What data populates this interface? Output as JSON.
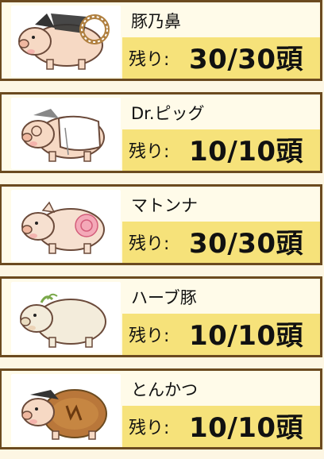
{
  "pigs": [
    {
      "name": "豚乃鼻",
      "remaining_label": "残り:",
      "remaining": "30/30頭",
      "icon": "pig-with-rope-icon"
    },
    {
      "name": "Dr.ピッグ",
      "remaining_label": "残り:",
      "remaining": "10/10頭",
      "icon": "doctor-pig-icon"
    },
    {
      "name": "マトンナ",
      "remaining_label": "残り:",
      "remaining": "30/30頭",
      "icon": "rose-pig-icon"
    },
    {
      "name": "ハーブ豚",
      "remaining_label": "残り:",
      "remaining": "10/10頭",
      "icon": "herb-pig-icon"
    },
    {
      "name": "とんかつ",
      "remaining_label": "残り:",
      "remaining": "10/10頭",
      "icon": "tonkatsu-pig-icon"
    }
  ],
  "colors": {
    "border": "#6b4a1f",
    "card_bg": "#fffbe9",
    "count_band": "#f6e27a",
    "pig_body": "#f6d9c4",
    "pig_outline": "#6b4a3a"
  }
}
